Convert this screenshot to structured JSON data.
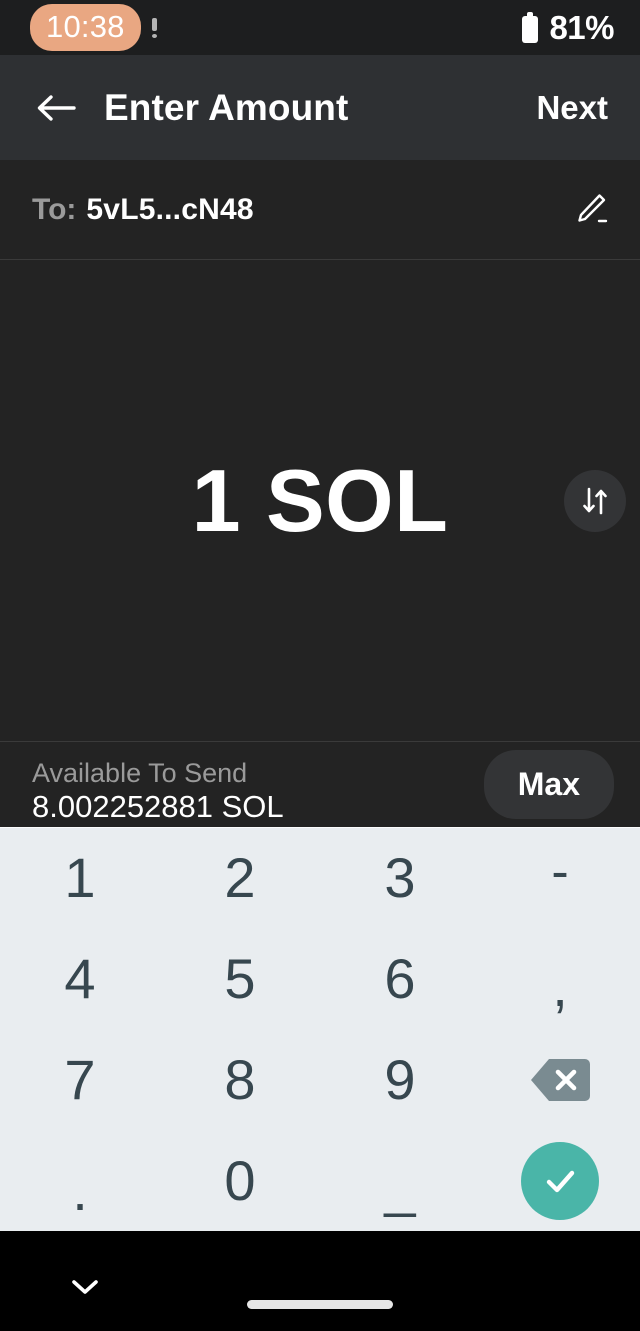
{
  "status_bar": {
    "time": "10:38",
    "time_pill_color": "#e9a782",
    "battery_percent": "81%",
    "notification_icon": "exclamation-icon",
    "battery_icon": "battery-icon"
  },
  "app_bar": {
    "back_icon": "back-arrow-icon",
    "title": "Enter Amount",
    "next_label": "Next"
  },
  "recipient": {
    "label": "To:",
    "address": "5vL5...cN48",
    "edit_icon": "pencil-edit-icon"
  },
  "amount": {
    "value": "1 SOL",
    "swap_icon": "swap-vertical-icon"
  },
  "available": {
    "label": "Available To Send",
    "value": "8.002252881 SOL",
    "max_label": "Max"
  },
  "keypad": {
    "background": "#e9edf0",
    "key_text_color": "#37474f",
    "enter_color": "#4ab5a8",
    "backspace_color": "#7a8b91",
    "keys": [
      {
        "label": "1",
        "kind": "digit",
        "name": "key-1"
      },
      {
        "label": "2",
        "kind": "digit",
        "name": "key-2"
      },
      {
        "label": "3",
        "kind": "digit",
        "name": "key-3"
      },
      {
        "label": "-",
        "kind": "dash",
        "name": "key-minus"
      },
      {
        "label": "4",
        "kind": "digit",
        "name": "key-4"
      },
      {
        "label": "5",
        "kind": "digit",
        "name": "key-5"
      },
      {
        "label": "6",
        "kind": "digit",
        "name": "key-6"
      },
      {
        "label": ",",
        "kind": "comma",
        "name": "key-comma"
      },
      {
        "label": "7",
        "kind": "digit",
        "name": "key-7"
      },
      {
        "label": "8",
        "kind": "digit",
        "name": "key-8"
      },
      {
        "label": "9",
        "kind": "digit",
        "name": "key-9"
      },
      {
        "label": "",
        "kind": "backspace",
        "name": "key-backspace"
      },
      {
        "label": ".",
        "kind": "period",
        "name": "key-period"
      },
      {
        "label": "0",
        "kind": "digit",
        "name": "key-0"
      },
      {
        "label": "_",
        "kind": "uscore",
        "name": "key-space"
      },
      {
        "label": "",
        "kind": "enter",
        "name": "key-enter"
      }
    ]
  },
  "nav_bar": {
    "dismiss_icon": "chevron-down-icon",
    "home_indicator": "home-indicator"
  }
}
